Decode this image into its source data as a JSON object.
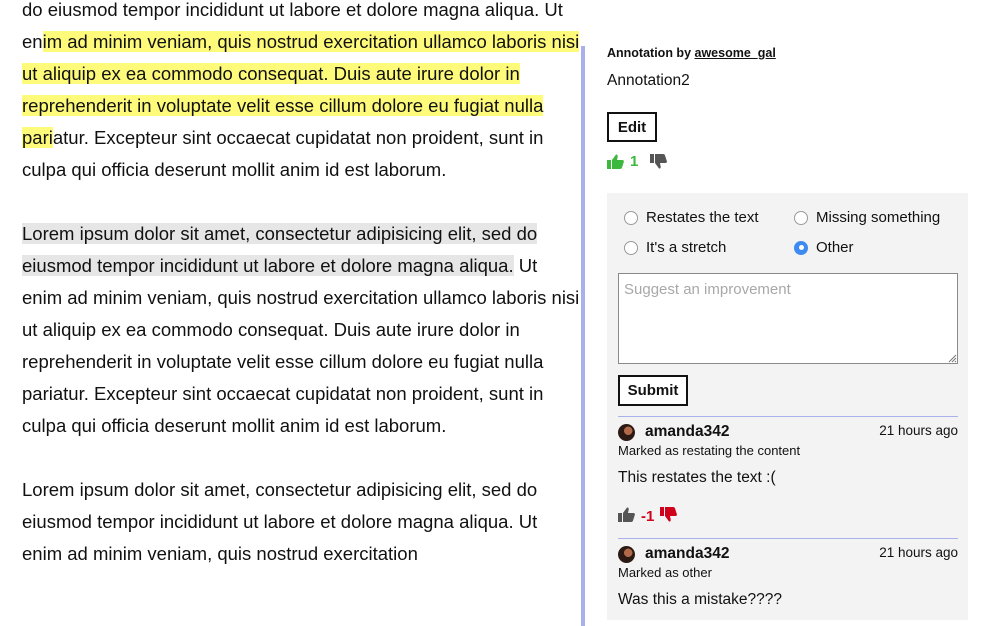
{
  "document": {
    "p1": {
      "before": "do eiusmod tempor incididunt ut labore et dolore magna aliqua. Ut en",
      "highlight": "im ad minim veniam, quis nostrud exercitation ullamco laboris nisi ut aliquip ex ea commodo consequat. Duis aute irure dolor in reprehenderit in voluptate velit esse cillum dolore eu fugiat nulla pari",
      "after": "atur. Excepteur sint occaecat cupidatat non proident, sunt in culpa qui officia deserunt mollit anim id est laborum."
    },
    "p2": {
      "highlight": "Lorem ipsum dolor sit amet, consectetur adipisicing elit, sed do eiusmod tempor incididunt ut labore et dolore magna aliqua.",
      "after": " Ut enim ad minim veniam, quis nostrud exercitation ullamco laboris nisi ut aliquip ex ea commodo consequat. Duis aute irure dolor in reprehenderit in voluptate velit esse cillum dolore eu fugiat nulla pariatur. Excepteur sint occaecat cupidatat non proident, sunt in culpa qui officia deserunt mollit anim id est laborum."
    },
    "p3": {
      "text": "Lorem ipsum dolor sit amet, consectetur adipisicing elit, sed do eiusmod tempor incididunt ut labore et dolore magna aliqua. Ut enim ad minim veniam, quis nostrud exercitation"
    }
  },
  "annotation": {
    "by_label": "Annotation by",
    "author": "awesome_gal",
    "body": "Annotation2",
    "edit_label": "Edit",
    "score": "1"
  },
  "feedback": {
    "options": [
      {
        "label": "Restates the text",
        "selected": false
      },
      {
        "label": "Missing something",
        "selected": false
      },
      {
        "label": "It's a stretch",
        "selected": false
      },
      {
        "label": "Other",
        "selected": true
      }
    ],
    "suggest_placeholder": "Suggest an improvement",
    "submit_label": "Submit"
  },
  "comments": [
    {
      "user": "amanda342",
      "time": "21 hours ago",
      "marked": "Marked as restating the content",
      "text": "This restates the text :(",
      "score": "-1"
    },
    {
      "user": "amanda342",
      "time": "21 hours ago",
      "marked": "Marked as other",
      "text": "Was this a mistake????"
    }
  ],
  "colors": {
    "highlight_yellow": "#fffb7a",
    "highlight_gray": "#e6e6e6",
    "panel_accent": "#a9b0ec",
    "upvote_green": "#3cb93c",
    "downvote_red": "#d0021b",
    "radio_selected": "#3d8bf0"
  },
  "icons": [
    "thumbs-up-icon",
    "thumbs-down-icon",
    "avatar",
    "resize-grip-icon"
  ]
}
